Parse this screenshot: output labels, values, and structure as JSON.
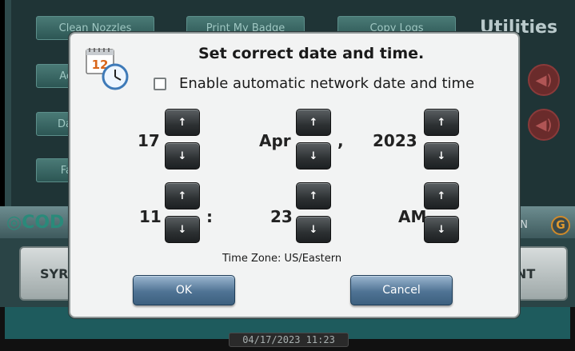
{
  "background": {
    "buttons_row": [
      "Clean Nozzles",
      "Print My Badge",
      "Copy Logs"
    ],
    "side_buttons": [
      "Ac",
      "Da",
      "Fa"
    ],
    "section_title": "Utilities",
    "brand": "COD",
    "status": "ON",
    "status_glyph": "G",
    "big_button_left": "SYR",
    "big_button_right": "ENT",
    "clock": "04/17/2023 11:23"
  },
  "dialog": {
    "title": "Set correct date and time.",
    "auto_checkbox_label": "Enable automatic network date and time",
    "auto_checked": false,
    "day": "17",
    "month": "Apr",
    "year": "2023",
    "hour": "11",
    "minute": "23",
    "ampm": "AM",
    "date_sep": ",",
    "time_sep": ":",
    "up_glyph": "↑",
    "down_glyph": "↓",
    "timezone": "Time Zone: US/Eastern",
    "ok_label": "OK",
    "cancel_label": "Cancel",
    "calendar_number": "12",
    "icons": {
      "calendar": "calendar-clock-icon",
      "speaker": "speaker-icon"
    }
  }
}
